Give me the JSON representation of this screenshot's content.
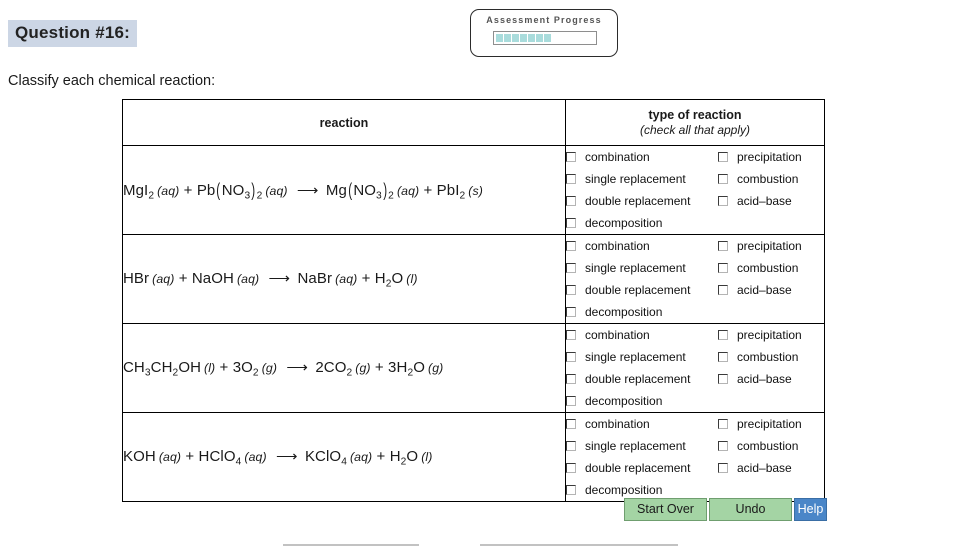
{
  "question": {
    "header": "Question #16:",
    "prompt": "Classify each chemical reaction:"
  },
  "progress": {
    "label": "Assessment Progress",
    "filled_blocks": 7,
    "fill_color": "#a9dcdc"
  },
  "table": {
    "headers": {
      "reaction": "reaction",
      "type": "type of reaction",
      "type_sub": "(check all that apply)"
    },
    "rows": [
      {
        "equation": {
          "reactant1": "MgI",
          "reactant1_sub": "2",
          "reactant1_state": "(aq)",
          "plus1": "+",
          "reactant2_a": "Pb",
          "reactant2_group": "NO",
          "reactant2_group_sub": "3",
          "reactant2_outer_sub": "2",
          "reactant2_state": "(aq)",
          "arrow": "⟶",
          "product1_a": "Mg",
          "product1_group": "NO",
          "product1_group_sub": "3",
          "product1_outer_sub": "2",
          "product1_state": "(aq)",
          "plus2": "+",
          "product2": "PbI",
          "product2_sub": "2",
          "product2_state": "(s)"
        },
        "options": {
          "combination": "combination",
          "single_replacement": "single replacement",
          "double_replacement": "double replacement",
          "decomposition": "decomposition",
          "precipitation": "precipitation",
          "combustion": "combustion",
          "acid_base": "acid–base"
        }
      },
      {
        "equation": {
          "reactant1": "HBr",
          "reactant1_state": "(aq)",
          "plus1": "+",
          "reactant2": "NaOH",
          "reactant2_state": "(aq)",
          "arrow": "⟶",
          "product1": "NaBr",
          "product1_state": "(aq)",
          "plus2": "+",
          "product2_a": "H",
          "product2_sub": "2",
          "product2_b": "O",
          "product2_state": "(l)"
        },
        "options": {
          "combination": "combination",
          "single_replacement": "single replacement",
          "double_replacement": "double replacement",
          "decomposition": "decomposition",
          "precipitation": "precipitation",
          "combustion": "combustion",
          "acid_base": "acid–base"
        }
      },
      {
        "equation": {
          "reactant1_a": "CH",
          "reactant1_sub1": "3",
          "reactant1_b": "CH",
          "reactant1_sub2": "2",
          "reactant1_c": "OH",
          "reactant1_state": "(l)",
          "plus1": "+",
          "reactant2_coef": "3",
          "reactant2_a": "O",
          "reactant2_sub": "2",
          "reactant2_state": "(g)",
          "arrow": "⟶",
          "product1_coef": "2",
          "product1_a": "CO",
          "product1_sub": "2",
          "product1_state": "(g)",
          "plus2": "+",
          "product2_coef": "3",
          "product2_a": "H",
          "product2_sub": "2",
          "product2_b": "O",
          "product2_state": "(g)"
        },
        "options": {
          "combination": "combination",
          "single_replacement": "single replacement",
          "double_replacement": "double replacement",
          "decomposition": "decomposition",
          "precipitation": "precipitation",
          "combustion": "combustion",
          "acid_base": "acid–base"
        }
      },
      {
        "equation": {
          "reactant1": "KOH",
          "reactant1_state": "(aq)",
          "plus1": "+",
          "reactant2_a": "HClO",
          "reactant2_sub": "4",
          "reactant2_state": "(aq)",
          "arrow": "⟶",
          "product1_a": "KClO",
          "product1_sub": "4",
          "product1_state": "(aq)",
          "plus2": "+",
          "product2_a": "H",
          "product2_sub": "2",
          "product2_b": "O",
          "product2_state": "(l)"
        },
        "options": {
          "combination": "combination",
          "single_replacement": "single replacement",
          "double_replacement": "double replacement",
          "decomposition": "decomposition",
          "precipitation": "precipitation",
          "combustion": "combustion",
          "acid_base": "acid–base"
        }
      }
    ]
  },
  "buttons": {
    "start_over": "Start Over",
    "undo": "Undo",
    "help": "Help",
    "green_color": "#a4d4a4",
    "blue_color": "#4a86c8"
  }
}
